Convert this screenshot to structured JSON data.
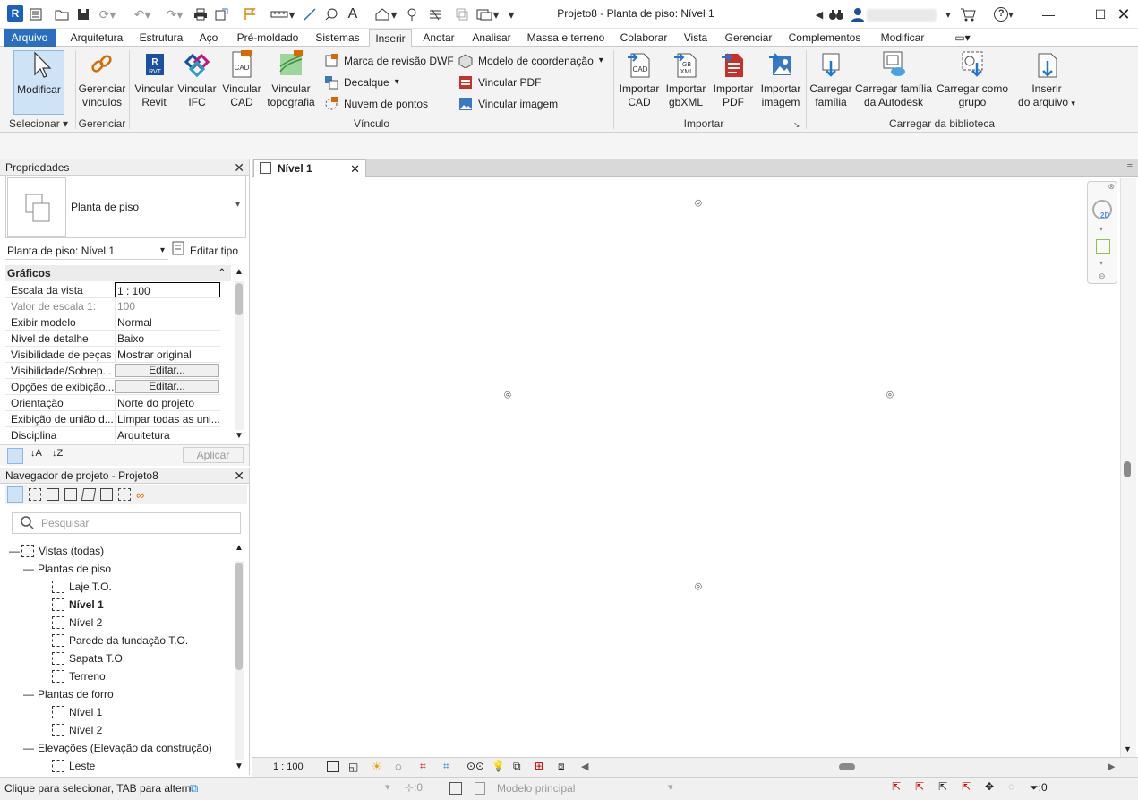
{
  "window": {
    "title": "Projeto8 - Planta de piso: Nível 1",
    "app_badge": "R",
    "user_name": "",
    "help_label": "?"
  },
  "tabs": [
    "Arquivo",
    "Arquitetura",
    "Estrutura",
    "Aço",
    "Pré-moldado",
    "Sistemas",
    "Inserir",
    "Anotar",
    "Analisar",
    "Massa e terreno",
    "Colaborar",
    "Vista",
    "Gerenciar",
    "Complementos",
    "Modificar"
  ],
  "active_tab": "Inserir",
  "ribbon": {
    "modificar": "Modificar",
    "gerenciar_vinculos": [
      "Gerenciar",
      "vínculos"
    ],
    "vincular_revit": [
      "Vincular",
      "Revit"
    ],
    "vincular_ifc": [
      "Vincular",
      "IFC"
    ],
    "vincular_cad": [
      "Vincular",
      "CAD"
    ],
    "vincular_topografia": [
      "Vincular",
      "topografia"
    ],
    "marca_revisao_dwf": "Marca de revisão  DWF",
    "decalque": "Decalque",
    "nuvem_pontos": "Nuvem  de pontos",
    "modelo_coordenacao": "Modelo de  coordenação",
    "vincular_pdf": "Vincular  PDF",
    "vincular_imagem": "Vincular  imagem",
    "importar_cad": [
      "Importar",
      "CAD"
    ],
    "importar_gbxml": [
      "Importar",
      "gbXML"
    ],
    "importar_pdf": [
      "Importar",
      "PDF"
    ],
    "importar_imagem": [
      "Importar",
      "imagem"
    ],
    "carregar_familia": [
      "Carregar",
      "família"
    ],
    "carregar_familia_autodesk": [
      "Carregar família",
      "da Autodesk"
    ],
    "carregar_como_grupo": [
      "Carregar como",
      "grupo"
    ],
    "inserir_arquivo": [
      "Inserir",
      "do arquivo"
    ],
    "panels": {
      "selecionar": "Selecionar",
      "gerenciar": "Gerenciar",
      "vinculo": "Vínculo",
      "importar": "Importar",
      "carregar_biblioteca": "Carregar da biblioteca"
    },
    "icon_labels": {
      "rvt": "RVT",
      "cad": "CAD",
      "gbxml_gb": "GB",
      "gbxml_xml": "XML"
    }
  },
  "properties": {
    "title": "Propriedades",
    "type_name": "Planta de piso",
    "instance_selector": "Planta de piso: Nível 1",
    "edit_type": "Editar tipo",
    "group": "Gráficos",
    "rows": [
      {
        "key": "Escala da vista",
        "value": "1 : 100"
      },
      {
        "key": "Valor de escala   1:",
        "value": "100"
      },
      {
        "key": "Exibir modelo",
        "value": "Normal"
      },
      {
        "key": "Nível de detalhe",
        "value": "Baixo"
      },
      {
        "key": "Visibilidade de peças",
        "value": "Mostrar original"
      },
      {
        "key": "Visibilidade/Sobrep...",
        "value": "Editar..."
      },
      {
        "key": "Opções de exibição...",
        "value": "Editar..."
      },
      {
        "key": "Orientação",
        "value": "Norte do projeto"
      },
      {
        "key": "Exibição de união d...",
        "value": "Limpar todas as uni..."
      },
      {
        "key": "Disciplina",
        "value": "Arquitetura"
      }
    ],
    "apply": "Aplicar"
  },
  "browser": {
    "title": "Navegador de projeto - Projeto8",
    "search_placeholder": "Pesquisar",
    "tree": [
      {
        "label": "Vistas (todas)",
        "level": 0,
        "bold": false
      },
      {
        "label": "Plantas de piso",
        "level": 1,
        "bold": false
      },
      {
        "label": "Laje T.O.",
        "level": 2,
        "bold": false
      },
      {
        "label": "Nível 1",
        "level": 2,
        "bold": true
      },
      {
        "label": "Nível 2",
        "level": 2,
        "bold": false
      },
      {
        "label": "Parede da fundação T.O.",
        "level": 2,
        "bold": false
      },
      {
        "label": "Sapata T.O.",
        "level": 2,
        "bold": false
      },
      {
        "label": "Terreno",
        "level": 2,
        "bold": false
      },
      {
        "label": "Plantas de forro",
        "level": 1,
        "bold": false
      },
      {
        "label": "Nível 1",
        "level": 2,
        "bold": false
      },
      {
        "label": "Nível 2",
        "level": 2,
        "bold": false
      },
      {
        "label": "Elevações (Elevação da construção)",
        "level": 1,
        "bold": false
      },
      {
        "label": "Leste",
        "level": 2,
        "bold": false
      }
    ]
  },
  "view": {
    "tab_title": "Nível 1",
    "scale": "1 : 100",
    "navbar_2d": "2D"
  },
  "status": {
    "hint": "Clique para selecionar, TAB para altern",
    "workset_count": ":0",
    "model": "Modelo principal",
    "filter_count": ":0"
  },
  "colors": {
    "accent": "#2a6fbf",
    "selected_button": "#cfe3f7"
  }
}
